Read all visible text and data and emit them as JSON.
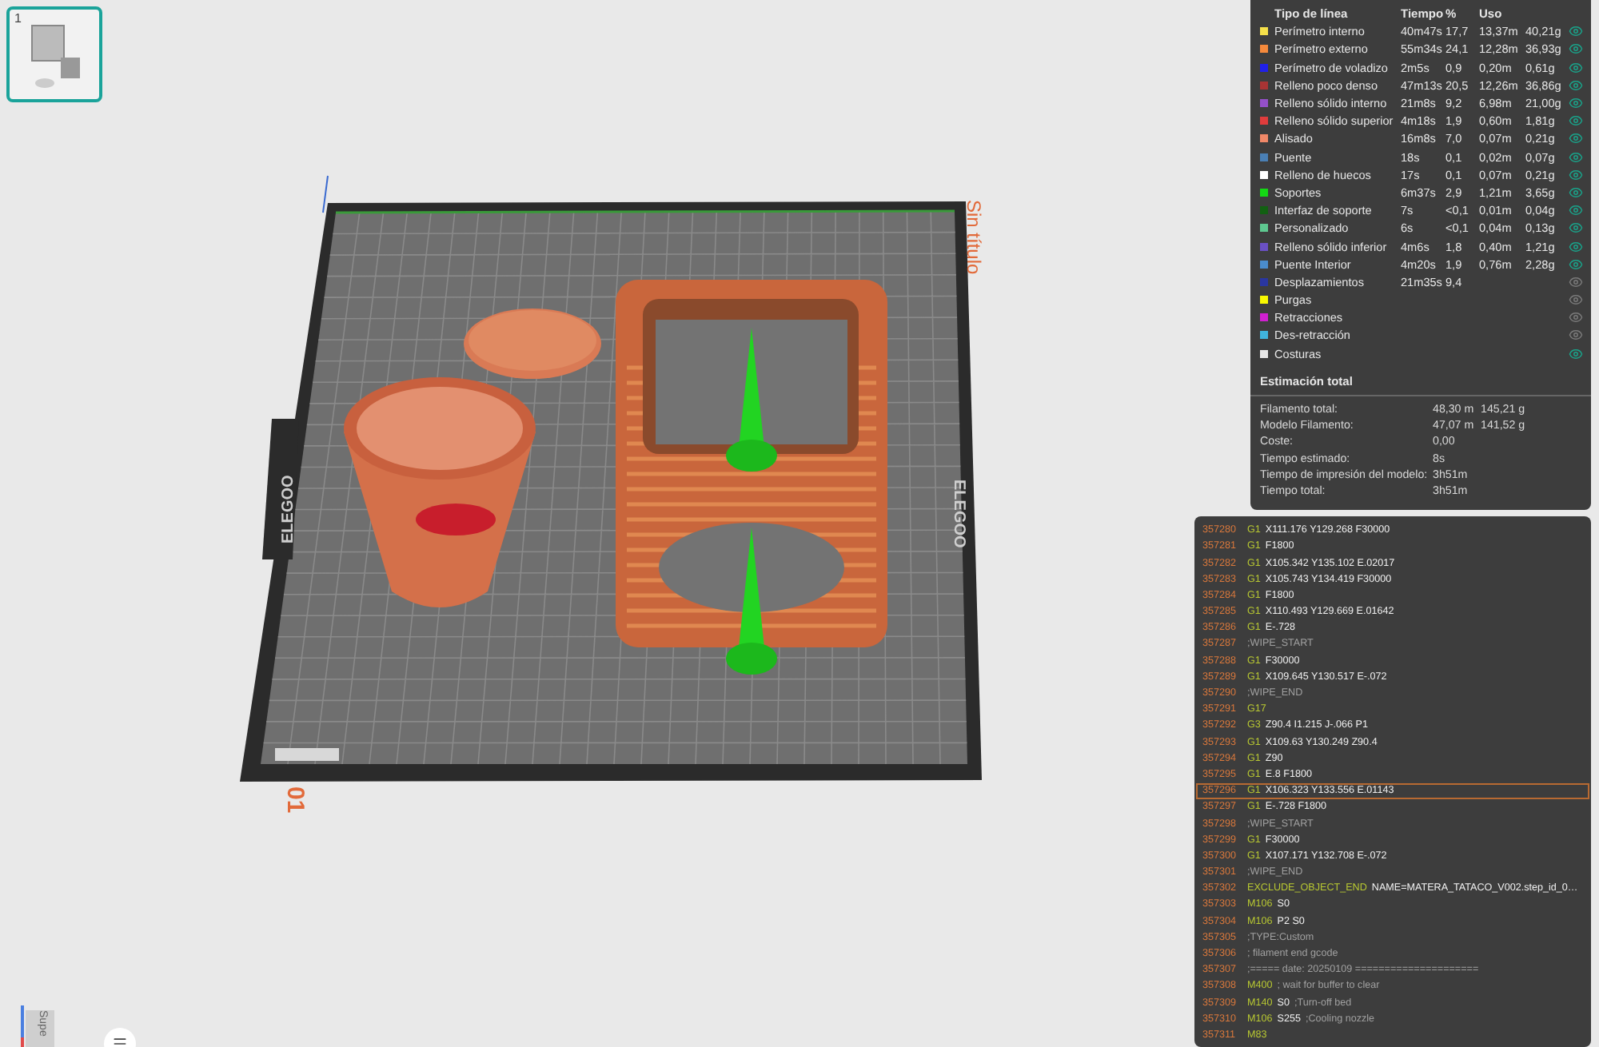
{
  "thumbnail": {
    "number": "1",
    "selected": true
  },
  "plate": {
    "name": "Sin título",
    "number": "01",
    "logos": [
      "ELEGOO",
      "ELEGOO"
    ]
  },
  "view_cube": {
    "label": "Supe"
  },
  "legend": {
    "columns": [
      "Tipo de línea",
      "Tiempo",
      "%",
      "Uso"
    ],
    "rows": [
      {
        "name": "Perímetro interno",
        "color": "#f5e04a",
        "time": "40m47s",
        "percent": "17,7",
        "length": "13,37m",
        "weight": "40,21g",
        "visible": true
      },
      {
        "name": "Perímetro externo",
        "color": "#f58a3c",
        "time": "55m34s",
        "percent": "24,1",
        "length": "12,28m",
        "weight": "36,93g",
        "visible": true
      },
      {
        "name": "Perímetro de voladizo",
        "color": "#2020e8",
        "time": "2m5s",
        "percent": "0,9",
        "length": "0,20m",
        "weight": "0,61g",
        "visible": true
      },
      {
        "name": "Relleno poco denso",
        "color": "#a83434",
        "time": "47m13s",
        "percent": "20,5",
        "length": "12,26m",
        "weight": "36,86g",
        "visible": true
      },
      {
        "name": "Relleno sólido interno",
        "color": "#9450c8",
        "time": "21m8s",
        "percent": "9,2",
        "length": "6,98m",
        "weight": "21,00g",
        "visible": true
      },
      {
        "name": "Relleno sólido superior",
        "color": "#e03c3c",
        "time": "4m18s",
        "percent": "1,9",
        "length": "0,60m",
        "weight": "1,81g",
        "visible": true
      },
      {
        "name": "Alisado",
        "color": "#f08868",
        "time": "16m8s",
        "percent": "7,0",
        "length": "0,07m",
        "weight": "0,21g",
        "visible": true
      },
      {
        "name": "Puente",
        "color": "#4a7fb4",
        "time": "18s",
        "percent": "0,1",
        "length": "0,02m",
        "weight": "0,07g",
        "visible": true
      },
      {
        "name": "Relleno de huecos",
        "color": "#ffffff",
        "time": "17s",
        "percent": "0,1",
        "length": "0,07m",
        "weight": "0,21g",
        "visible": true
      },
      {
        "name": "Soportes",
        "color": "#14d814",
        "time": "6m37s",
        "percent": "2,9",
        "length": "1,21m",
        "weight": "3,65g",
        "visible": true
      },
      {
        "name": "Interfaz de soporte",
        "color": "#126012",
        "time": "7s",
        "percent": "<0,1",
        "length": "0,01m",
        "weight": "0,04g",
        "visible": true
      },
      {
        "name": "Personalizado",
        "color": "#5ec890",
        "time": "6s",
        "percent": "<0,1",
        "length": "0,04m",
        "weight": "0,13g",
        "visible": true
      },
      {
        "name": "Relleno sólido inferior",
        "color": "#6a50c4",
        "time": "4m6s",
        "percent": "1,8",
        "length": "0,40m",
        "weight": "1,21g",
        "visible": true
      },
      {
        "name": "Puente Interior",
        "color": "#4a8ccc",
        "time": "4m20s",
        "percent": "1,9",
        "length": "0,76m",
        "weight": "2,28g",
        "visible": true
      },
      {
        "name": "Desplazamientos",
        "color": "#2a36a0",
        "time": "21m35s",
        "percent": "9,4",
        "visible": false
      },
      {
        "name": "Purgas",
        "color": "#f8f800",
        "visible": false
      },
      {
        "name": "Retracciones",
        "color": "#d020d0",
        "visible": false
      },
      {
        "name": "Des-retracción",
        "color": "#40b4dc",
        "visible": false
      },
      {
        "name": "Costuras",
        "color": "#e6e6e6",
        "visible": true
      }
    ]
  },
  "estimate": {
    "title": "Estimación total",
    "rows": [
      {
        "label": "Filamento total:",
        "values": [
          "48,30 m",
          "145,21 g"
        ]
      },
      {
        "label": "Modelo Filamento:",
        "values": [
          "47,07 m",
          "141,52 g"
        ]
      },
      {
        "label": "Coste:",
        "values": [
          "0,00"
        ]
      },
      {
        "label": "Tiempo estimado:",
        "values": [
          "8s"
        ]
      },
      {
        "label": "Tiempo de impresión del modelo:",
        "values": [
          "3h51m"
        ]
      },
      {
        "label": "Tiempo total:",
        "values": [
          "3h51m"
        ]
      }
    ]
  },
  "gcode": {
    "lines": [
      {
        "number": "357280",
        "command": "G1",
        "args": "X111.176 Y129.268 F30000",
        "selected": false
      },
      {
        "number": "357281",
        "command": "G1",
        "args": "F1800",
        "selected": false
      },
      {
        "number": "357282",
        "command": "G1",
        "args": "X105.342 Y135.102 E.02017",
        "selected": false
      },
      {
        "number": "357283",
        "command": "G1",
        "args": "X105.743 Y134.419 F30000",
        "selected": false
      },
      {
        "number": "357284",
        "command": "G1",
        "args": "F1800",
        "selected": false
      },
      {
        "number": "357285",
        "command": "G1",
        "args": "X110.493 Y129.669 E.01642",
        "selected": false
      },
      {
        "number": "357286",
        "command": "G1",
        "args": "E-.728",
        "selected": false
      },
      {
        "number": "357287",
        "comment": ";WIPE_START",
        "selected": false
      },
      {
        "number": "357288",
        "command": "G1",
        "args": "F30000",
        "selected": false
      },
      {
        "number": "357289",
        "command": "G1",
        "args": "X109.645 Y130.517 E-.072",
        "selected": false
      },
      {
        "number": "357290",
        "comment": ";WIPE_END",
        "selected": false
      },
      {
        "number": "357291",
        "command": "G17",
        "selected": false
      },
      {
        "number": "357292",
        "command": "G3",
        "args": "Z90.4 I1.215 J-.066 P1",
        "selected": false
      },
      {
        "number": "357293",
        "command": "G1",
        "args": "X109.63 Y130.249 Z90.4",
        "selected": false
      },
      {
        "number": "357294",
        "command": "G1",
        "args": "Z90",
        "selected": false
      },
      {
        "number": "357295",
        "command": "G1",
        "args": "E.8 F1800",
        "selected": false
      },
      {
        "number": "357296",
        "command": "G1",
        "args": "X106.323 Y133.556 E.01143",
        "selected": true
      },
      {
        "number": "357297",
        "command": "G1",
        "args": "E-.728 F1800",
        "selected": false
      },
      {
        "number": "357298",
        "comment": ";WIPE_START",
        "selected": false
      },
      {
        "number": "357299",
        "command": "G1",
        "args": "F30000",
        "selected": false
      },
      {
        "number": "357300",
        "command": "G1",
        "args": "X107.171 Y132.708 E-.072",
        "selected": false
      },
      {
        "number": "357301",
        "comment": ";WIPE_END",
        "selected": false
      },
      {
        "number": "357302",
        "command": "EXCLUDE_OBJECT_END",
        "args": "NAME=MATERA_TATACO_V002.step_id_0…",
        "selected": false
      },
      {
        "number": "357303",
        "command": "M106",
        "args": "S0",
        "selected": false
      },
      {
        "number": "357304",
        "command": "M106",
        "args": "P2 S0",
        "selected": false
      },
      {
        "number": "357305",
        "comment": ";TYPE:Custom",
        "selected": false
      },
      {
        "number": "357306",
        "comment": "; filament end gcode",
        "selected": false
      },
      {
        "number": "357307",
        "comment": ";===== date: 20250109 =====================",
        "selected": false
      },
      {
        "number": "357308",
        "command": "M400",
        "comment": "; wait for buffer to clear",
        "selected": false
      },
      {
        "number": "357309",
        "command": "M140",
        "args": "S0",
        "comment": ";Turn-off bed",
        "selected": false
      },
      {
        "number": "357310",
        "command": "M106",
        "args": "S255",
        "comment": ";Cooling nozzle",
        "selected": false
      },
      {
        "number": "357311",
        "command": "M83",
        "selected": false
      }
    ]
  }
}
